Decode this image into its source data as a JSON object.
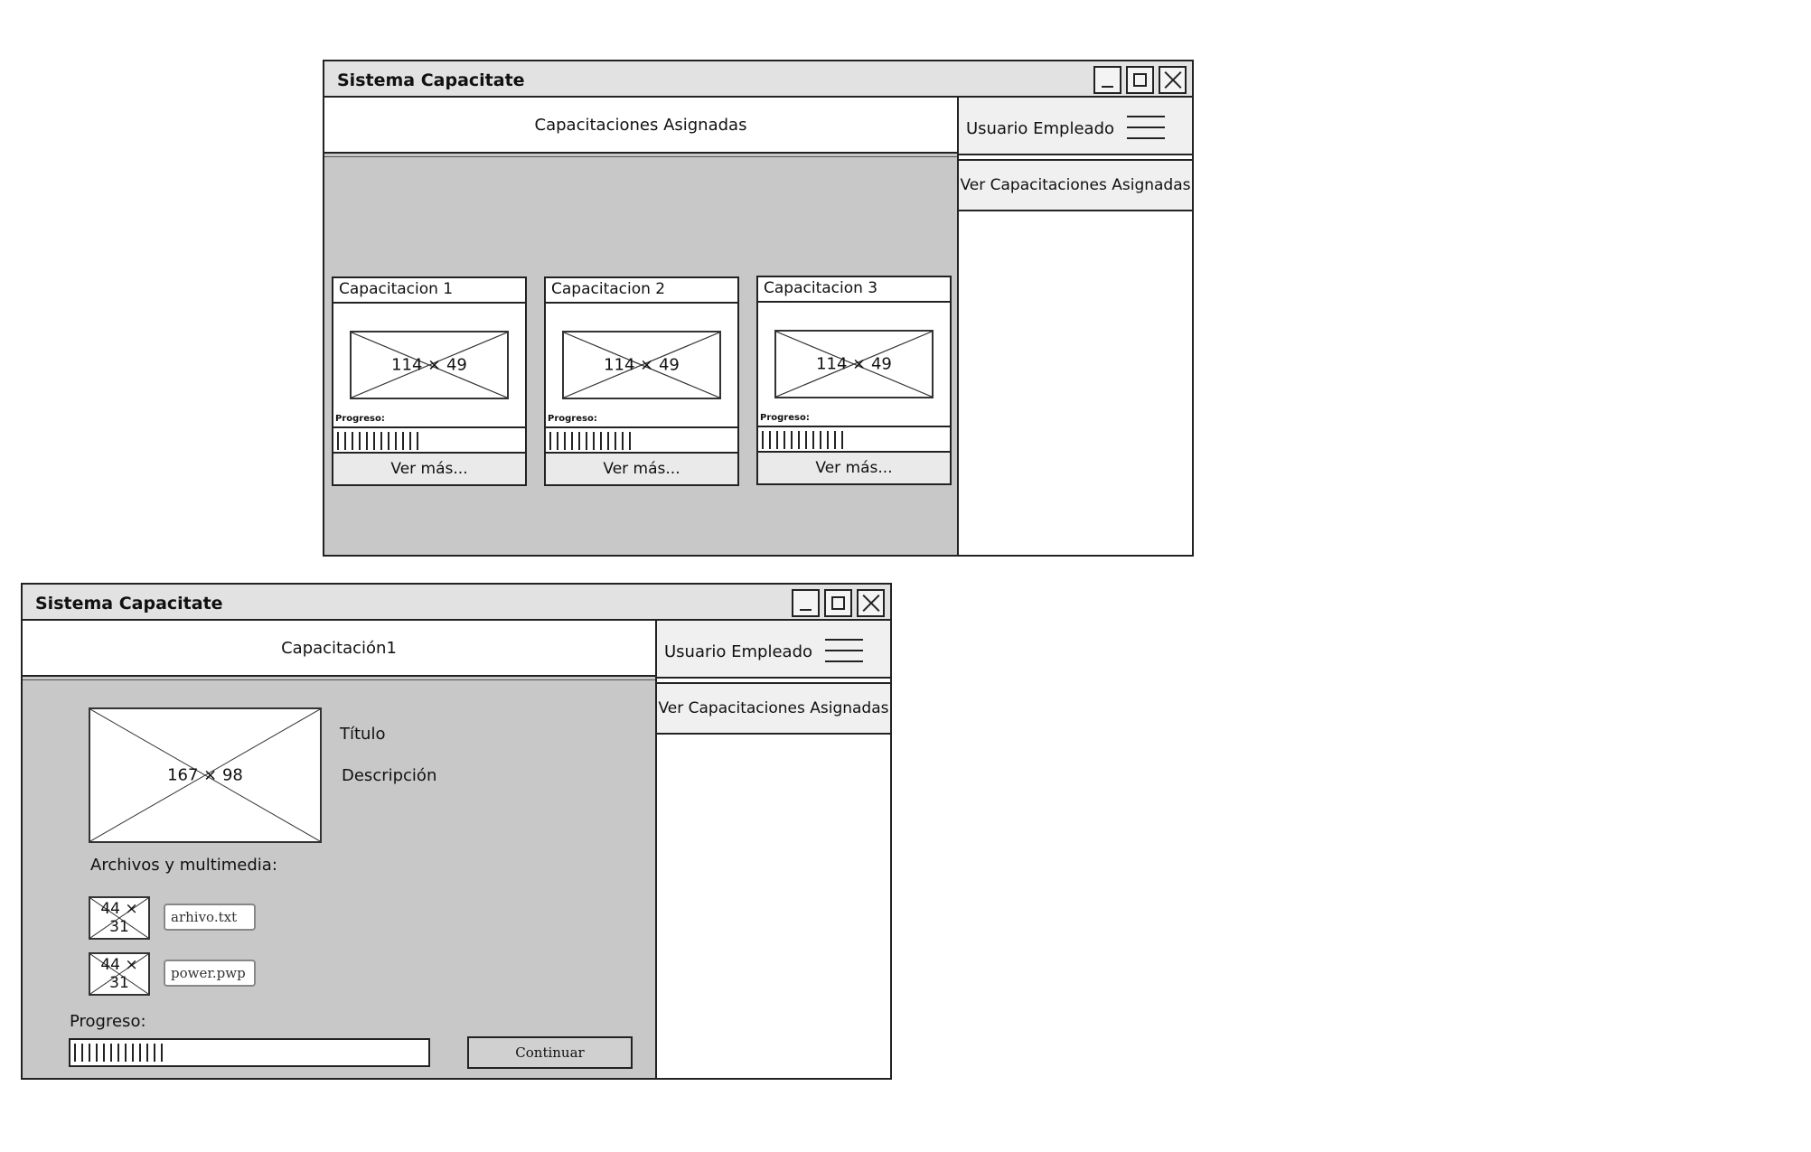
{
  "window1": {
    "title": "Sistema Capacitate",
    "header": "Capacitaciones Asignadas",
    "sidebar": {
      "user": "Usuario Empleado",
      "nav_item": "Ver Capacitaciones Asignadas"
    },
    "cards": [
      {
        "title": "Capacitacion 1",
        "image": "114 x 49",
        "progress_label": "Progreso:",
        "progress": 0.45,
        "button": "Ver más..."
      },
      {
        "title": "Capacitacion 2",
        "image": "114 x 49",
        "progress_label": "Progreso:",
        "progress": 0.45,
        "button": "Ver más..."
      },
      {
        "title": "Capacitacion 3",
        "image": "114 x 49",
        "progress_label": "Progreso:",
        "progress": 0.45,
        "button": "Ver más..."
      }
    ]
  },
  "window2": {
    "title": "Sistema Capacitate",
    "header": "Capacitación1",
    "sidebar": {
      "user": "Usuario Empleado",
      "nav_item": "Ver Capacitaciones Asignadas"
    },
    "detail": {
      "image": "167 x 98",
      "title_label": "Título",
      "description_label": "Descripción",
      "files_label": "Archivos y multimedia:",
      "files": [
        {
          "thumb": "44 x 31",
          "name": "arhivo.txt"
        },
        {
          "thumb": "44 x 31",
          "name": "power.pwp"
        }
      ],
      "progress_label": "Progreso:",
      "progress": 0.25,
      "continue_button": "Continuar"
    }
  }
}
